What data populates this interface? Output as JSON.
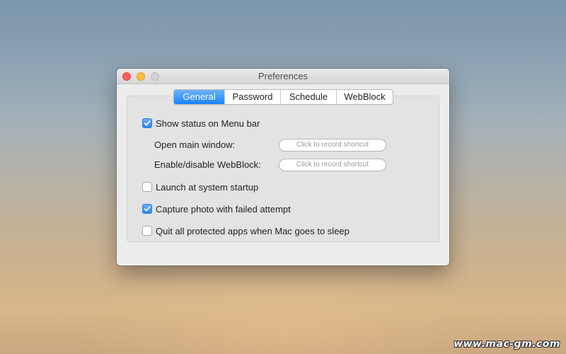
{
  "window": {
    "title": "Preferences"
  },
  "tabs": [
    {
      "label": "General",
      "active": true
    },
    {
      "label": "Password",
      "active": false
    },
    {
      "label": "Schedule",
      "active": false
    },
    {
      "label": "WebBlock",
      "active": false
    }
  ],
  "general": {
    "show_status": {
      "label": "Show status on Menu bar",
      "checked": true
    },
    "open_main_window": {
      "label": "Open main window:",
      "placeholder": "Click to record shortcut"
    },
    "enable_disable_webblock": {
      "label": "Enable/disable WebBlock:",
      "placeholder": "Click to record shortcut"
    },
    "launch_startup": {
      "label": "Launch at system startup",
      "checked": false
    },
    "capture_photo": {
      "label": "Capture photo with failed attempt",
      "checked": true
    },
    "quit_apps": {
      "label": "Quit all protected apps when Mac goes to sleep",
      "checked": false
    }
  },
  "watermark": "www.mac-gm.com",
  "colors": {
    "accent": "#1a82fb",
    "close": "#fc605c",
    "minimize": "#fdbc40",
    "zoom": "#cfcfcf"
  }
}
